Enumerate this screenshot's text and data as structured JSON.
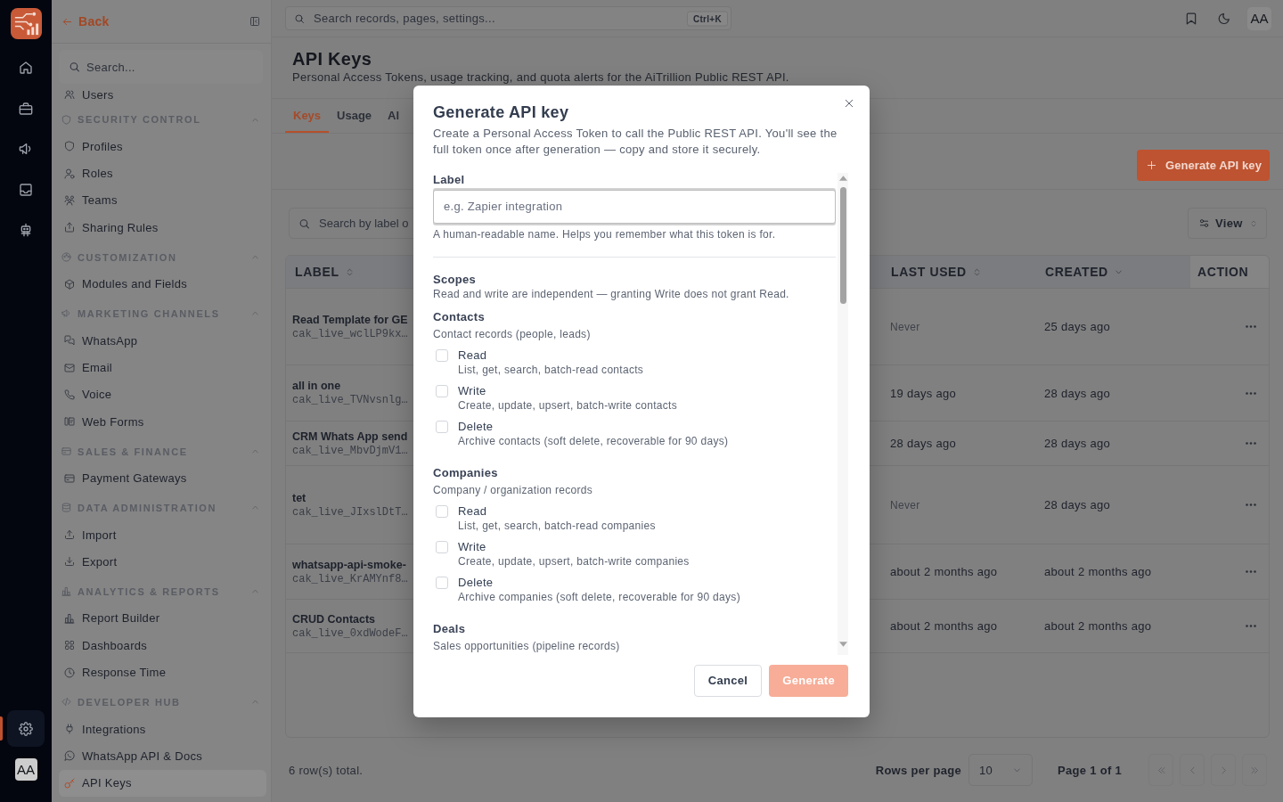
{
  "nav_rail": {
    "items": [
      {
        "selected": false
      },
      {
        "selected": false
      },
      {
        "selected": false
      },
      {
        "selected": false
      },
      {
        "selected": false
      }
    ],
    "bottom_items": [
      {
        "selected": true
      }
    ],
    "avatar": "AA"
  },
  "sidebar": {
    "back": "Back",
    "search": {
      "placeholder": "Search..."
    },
    "sections": [
      {
        "items": [
          {
            "label": "Users",
            "selected": false
          }
        ]
      },
      {
        "title": "SECURITY CONTROL",
        "expanded": true,
        "items": [
          {
            "label": "Profiles",
            "selected": false
          },
          {
            "label": "Roles",
            "selected": false
          },
          {
            "label": "Teams",
            "selected": false
          },
          {
            "label": "Sharing Rules",
            "selected": false
          }
        ]
      },
      {
        "title": "CUSTOMIZATION",
        "expanded": true,
        "items": [
          {
            "label": "Modules and Fields",
            "selected": false
          }
        ]
      },
      {
        "title": "MARKETING CHANNELS",
        "expanded": true,
        "items": [
          {
            "label": "WhatsApp",
            "selected": false
          },
          {
            "label": "Email",
            "selected": false
          },
          {
            "label": "Voice",
            "selected": false
          },
          {
            "label": "Web Forms",
            "selected": false
          }
        ]
      },
      {
        "title": "SALES & FINANCE",
        "expanded": true,
        "items": [
          {
            "label": "Payment Gateways",
            "selected": false
          }
        ]
      },
      {
        "title": "DATA ADMINISTRATION",
        "expanded": true,
        "items": [
          {
            "label": "Import",
            "selected": false
          },
          {
            "label": "Export",
            "selected": false
          }
        ]
      },
      {
        "title": "ANALYTICS & REPORTS",
        "expanded": true,
        "items": [
          {
            "label": "Report Builder",
            "selected": false
          },
          {
            "label": "Dashboards",
            "selected": false
          },
          {
            "label": "Response Time",
            "selected": false
          }
        ]
      },
      {
        "title": "DEVELOPER HUB",
        "expanded": true,
        "items": [
          {
            "label": "Integrations",
            "selected": false
          },
          {
            "label": "WhatsApp API & Docs",
            "selected": false
          },
          {
            "label": "API Keys",
            "selected": true
          }
        ]
      }
    ]
  },
  "topbar": {
    "search": {
      "placeholder": "Search records, pages, settings...",
      "shortcut": "Ctrl+K"
    },
    "avatar": "AA"
  },
  "page": {
    "title": "API Keys",
    "subtitle": "Personal Access Tokens, usage tracking, and quota alerts for the AiTrillion Public REST API."
  },
  "tabs": [
    {
      "label": "Keys",
      "selected": true
    },
    {
      "label": "Usage",
      "selected": false
    },
    {
      "label": "Al",
      "selected": false
    }
  ],
  "generate_button": "Generate API key",
  "table_search": {
    "placeholder": "Search by label o"
  },
  "view_button": "View",
  "table": {
    "columns": [
      {
        "label": "LABEL",
        "sortable": true,
        "sorted": false
      },
      {
        "label": "LAST USED",
        "sortable": true,
        "sorted": false
      },
      {
        "label": "CREATED",
        "sortable": true,
        "sorted": true
      },
      {
        "label": "ACTION",
        "sortable": false
      }
    ],
    "rows": [
      {
        "label": "Read Template for GE",
        "key": "cak_live_wclLP9kx…",
        "last_used": "Never",
        "never_used": true,
        "created": "25 days ago"
      },
      {
        "label": "all in one",
        "key": "cak_live_TVNvsnlg…",
        "last_used": "19 days ago",
        "never_used": false,
        "created": "28 days ago"
      },
      {
        "label": "CRM Whats App send",
        "key": "cak_live_MbvDjmV1…",
        "last_used": "28 days ago",
        "never_used": false,
        "created": "28 days ago"
      },
      {
        "label": "tet",
        "key": "cak_live_JIxslDtT…",
        "last_used": "Never",
        "never_used": true,
        "created": "28 days ago"
      },
      {
        "label": "whatsapp-api-smoke-",
        "key": "cak_live_KrAMYnf8…",
        "last_used": "about 2 months ago",
        "never_used": false,
        "created": "about 2 months ago"
      },
      {
        "label": "CRUD Contacts",
        "key": "cak_live_0xdWodeF…",
        "last_used": "about 2 months ago",
        "never_used": false,
        "created": "about 2 months ago"
      }
    ]
  },
  "footer": {
    "total": "6 row(s) total.",
    "rows_per_page_label": "Rows per page",
    "rows_per_page": "10",
    "page": "Page 1 of 1",
    "pager": [
      {
        "disabled": true
      },
      {
        "disabled": true
      },
      {
        "disabled": true
      },
      {
        "disabled": true
      }
    ]
  },
  "modal": {
    "title": "Generate API key",
    "description": "Create a Personal Access Token to call the Public REST API. You'll see the full token once after generation — copy and store it securely.",
    "label_field": {
      "label": "Label",
      "placeholder": "e.g. Zapier integration",
      "help": "A human-readable name. Helps you remember what this token is for."
    },
    "scopes": {
      "title": "Scopes",
      "description": "Read and write are independent — granting Write does not grant Read.",
      "groups": [
        {
          "name": "Contacts",
          "description": "Contact records (people, leads)",
          "permissions": [
            {
              "name": "Read",
              "description": "List, get, search, batch-read contacts",
              "checked": false
            },
            {
              "name": "Write",
              "description": "Create, update, upsert, batch-write contacts",
              "checked": false
            },
            {
              "name": "Delete",
              "description": "Archive contacts (soft delete, recoverable for 90 days)",
              "checked": false
            }
          ]
        },
        {
          "name": "Companies",
          "description": "Company / organization records",
          "permissions": [
            {
              "name": "Read",
              "description": "List, get, search, batch-read companies",
              "checked": false
            },
            {
              "name": "Write",
              "description": "Create, update, upsert, batch-write companies",
              "checked": false
            },
            {
              "name": "Delete",
              "description": "Archive companies (soft delete, recoverable for 90 days)",
              "checked": false
            }
          ]
        },
        {
          "name": "Deals",
          "description": "Sales opportunities (pipeline records)"
        }
      ]
    },
    "buttons": [
      {
        "label": "Cancel",
        "kind": "secondary",
        "disabled": false
      },
      {
        "label": "Generate",
        "kind": "primary",
        "disabled": true
      }
    ]
  }
}
